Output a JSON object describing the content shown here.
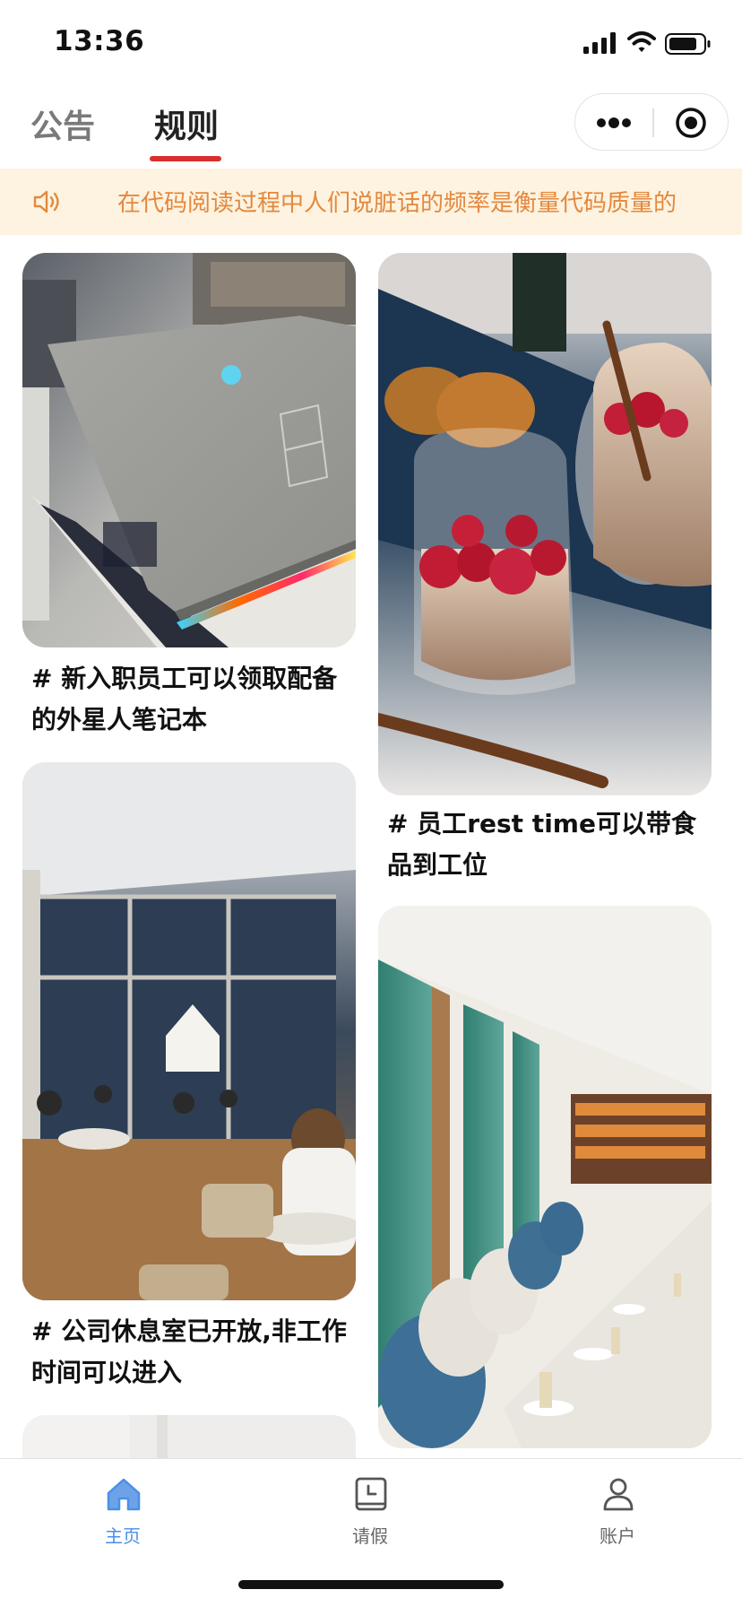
{
  "status": {
    "time": "13:36"
  },
  "header": {
    "tabs": [
      {
        "label": "公告",
        "active": false
      },
      {
        "label": "规则",
        "active": true
      }
    ],
    "accent_color": "#d8302f"
  },
  "notice": {
    "text": "在代码阅读过程中人们说脏话的频率是衡量代码质量的",
    "color": "#e4883d",
    "background": "#fdf3e0",
    "icon": "speaker-icon"
  },
  "feed": {
    "items": [
      {
        "title": "# 新入职员工可以领取配备的外星人笔记本",
        "image": "gray laptop with glowing alien logo in store"
      },
      {
        "title": "# 员工rest time可以带食品到工位",
        "image": "raspberry yogurt parfait in glass cups"
      },
      {
        "title": "# 公司休息室已开放,非工作时间可以进入",
        "image": "cafe interior with large windows and people seated"
      },
      {
        "title": "",
        "image": "long dining table with blue chairs and bookshelf"
      }
    ]
  },
  "tabbar": {
    "items": [
      {
        "label": "主页",
        "icon": "home-icon",
        "active": true
      },
      {
        "label": "请假",
        "icon": "calendar-clock-icon",
        "active": false
      },
      {
        "label": "账户",
        "icon": "user-icon",
        "active": false
      }
    ],
    "active_color": "#4a8fe7",
    "inactive_color": "#666666"
  }
}
